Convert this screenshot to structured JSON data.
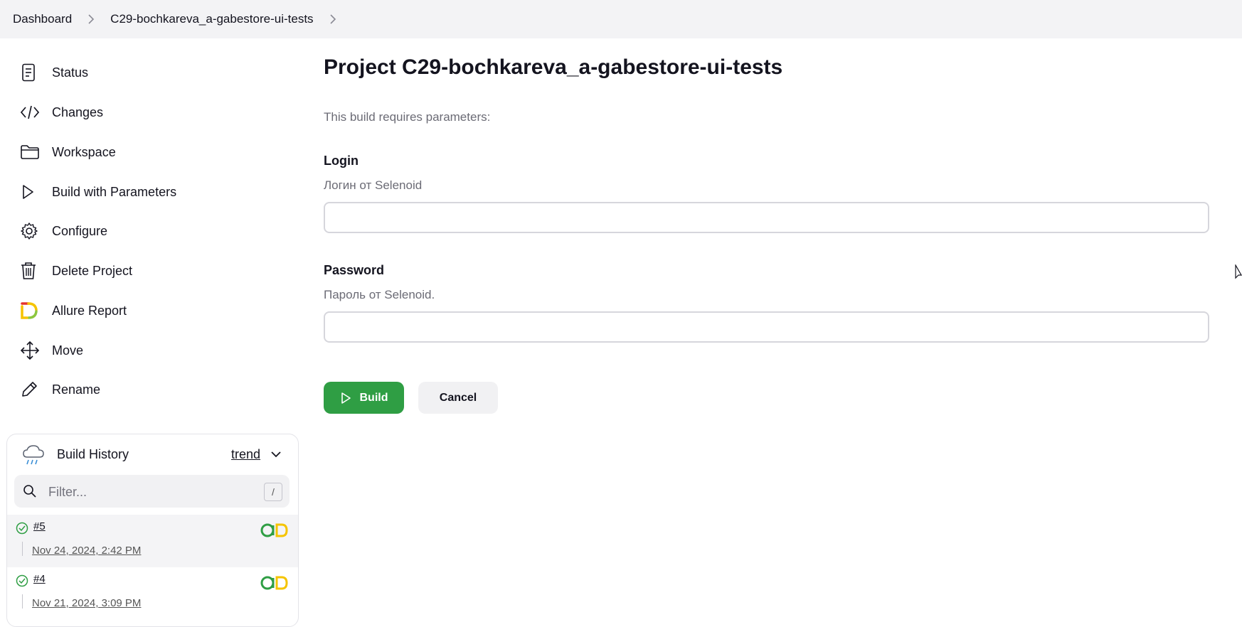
{
  "breadcrumb": {
    "items": [
      "Dashboard",
      "C29-bochkareva_a-gabestore-ui-tests"
    ]
  },
  "sidebar": {
    "items": [
      {
        "label": "Status",
        "icon": "document-icon"
      },
      {
        "label": "Changes",
        "icon": "code-icon"
      },
      {
        "label": "Workspace",
        "icon": "folder-icon"
      },
      {
        "label": "Build with Parameters",
        "icon": "play-icon"
      },
      {
        "label": "Configure",
        "icon": "gear-icon"
      },
      {
        "label": "Delete Project",
        "icon": "trash-icon"
      },
      {
        "label": "Allure Report",
        "icon": "allure-icon"
      },
      {
        "label": "Move",
        "icon": "move-icon"
      },
      {
        "label": "Rename",
        "icon": "pencil-icon"
      }
    ]
  },
  "build_history": {
    "title": "Build History",
    "trend_label": "trend",
    "filter_placeholder": "Filter...",
    "filter_shortcut": "/",
    "builds": [
      {
        "number": "#5",
        "date": "Nov 24, 2024, 2:42 PM",
        "status": "success"
      },
      {
        "number": "#4",
        "date": "Nov 21, 2024, 3:09 PM",
        "status": "success"
      }
    ]
  },
  "main": {
    "title": "Project C29-bochkareva_a-gabestore-ui-tests",
    "intro": "This build requires parameters:",
    "params": [
      {
        "label": "Login",
        "description": "Логин от Selenoid",
        "value": ""
      },
      {
        "label": "Password",
        "description": "Пароль от Selenoid.",
        "value": ""
      }
    ],
    "build_button": "Build",
    "cancel_button": "Cancel"
  },
  "colors": {
    "accent": "#2f9e44",
    "topbar": "#f3f3f5"
  }
}
